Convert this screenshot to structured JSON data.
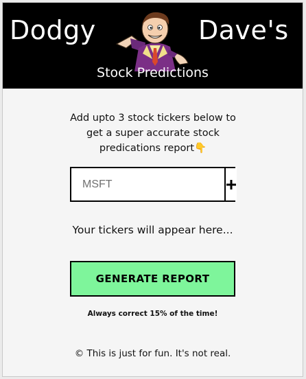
{
  "header": {
    "brand_left": "Dodgy",
    "brand_right": "Dave's",
    "subtitle": "Stock Predictions",
    "mascot_icon": "cartoon-salesman-mascot"
  },
  "intro": {
    "line1": "Add upto 3 stock tickers below to",
    "line2": "get a super accurate stock",
    "line3": "predications report",
    "emoji": "👇"
  },
  "ticker_input": {
    "placeholder": "MSFT",
    "value": ""
  },
  "add_button": {
    "icon": "plus-icon"
  },
  "tickers_hint": "Your tickers will appear here...",
  "generate_button": {
    "label": "GENERATE REPORT",
    "color": "#7ef59b"
  },
  "disclaimer": "Always correct 15% of the time!",
  "footer": "© This is just for fun. It's not real.",
  "colors": {
    "header_bg": "#000000",
    "page_bg": "#f5f5f5",
    "accent_green": "#7ef59b"
  }
}
